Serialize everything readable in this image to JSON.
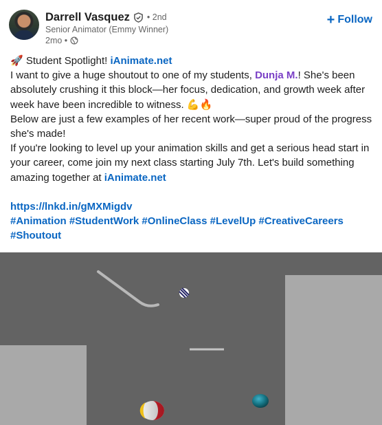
{
  "author": {
    "name": "Darrell Vasquez",
    "degree": "• 2nd",
    "headline": "Senior Animator (Emmy Winner)",
    "time": "2mo •"
  },
  "follow": {
    "label": "Follow"
  },
  "post": {
    "line1_prefix": "Student Spotlight! ",
    "line1_link": "iAnimate.net",
    "para1_prefix": " I want to give a huge shoutout to one of my students, ",
    "mention": "Dunja M.",
    "para1_suffix": "! She's been absolutely crushing it this block—her focus, dedication, and growth week after week have been incredible to witness.",
    "para2": "Below are just a few examples of her recent work—super proud of the progress she's made!",
    "para3": "If you're looking to level up your animation skills and get a serious head start in your career, come join my next class starting July 7th. Let's build something amazing together at ",
    "para3_link": "iAnimate.net",
    "short_link": "https://lnkd.in/gMXMigdv",
    "hashtags": "#Animation #StudentWork #OnlineClass #LevelUp #CreativeCareers #Shoutout"
  },
  "icons": {
    "verified": "shield-check-icon",
    "globe": "globe-icon",
    "rocket": "rocket-emoji",
    "muscle": "flexed-biceps-emoji",
    "fire": "fire-emoji"
  },
  "colors": {
    "link": "#0a66c2",
    "mention": "#7a3fc6",
    "scene_bg": "#636363",
    "scene_blocks": "#a9a9a9"
  }
}
